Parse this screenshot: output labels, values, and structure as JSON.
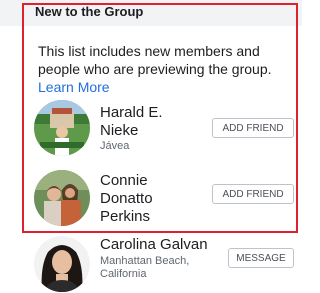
{
  "section": {
    "title": "New to the Group",
    "description": "This list includes new members and people who are previewing the group.",
    "learn_more": "Learn More"
  },
  "members": [
    {
      "name": "Harald E. Nieke",
      "subtitle": "Jávea",
      "action": "ADD FRIEND",
      "avatar_icon": "profile-photo-outdoor"
    },
    {
      "name": "Connie Donatto Perkins",
      "subtitle": "",
      "action": "ADD FRIEND",
      "avatar_icon": "profile-photo-couple"
    },
    {
      "name": "Carolina Galvan",
      "subtitle": "Manhattan Beach, California",
      "action": "MESSAGE",
      "avatar_icon": "profile-photo-woman"
    }
  ],
  "colors": {
    "header_bg": "#f2f3f5",
    "highlight": "#e0202c",
    "link": "#216fdb"
  }
}
